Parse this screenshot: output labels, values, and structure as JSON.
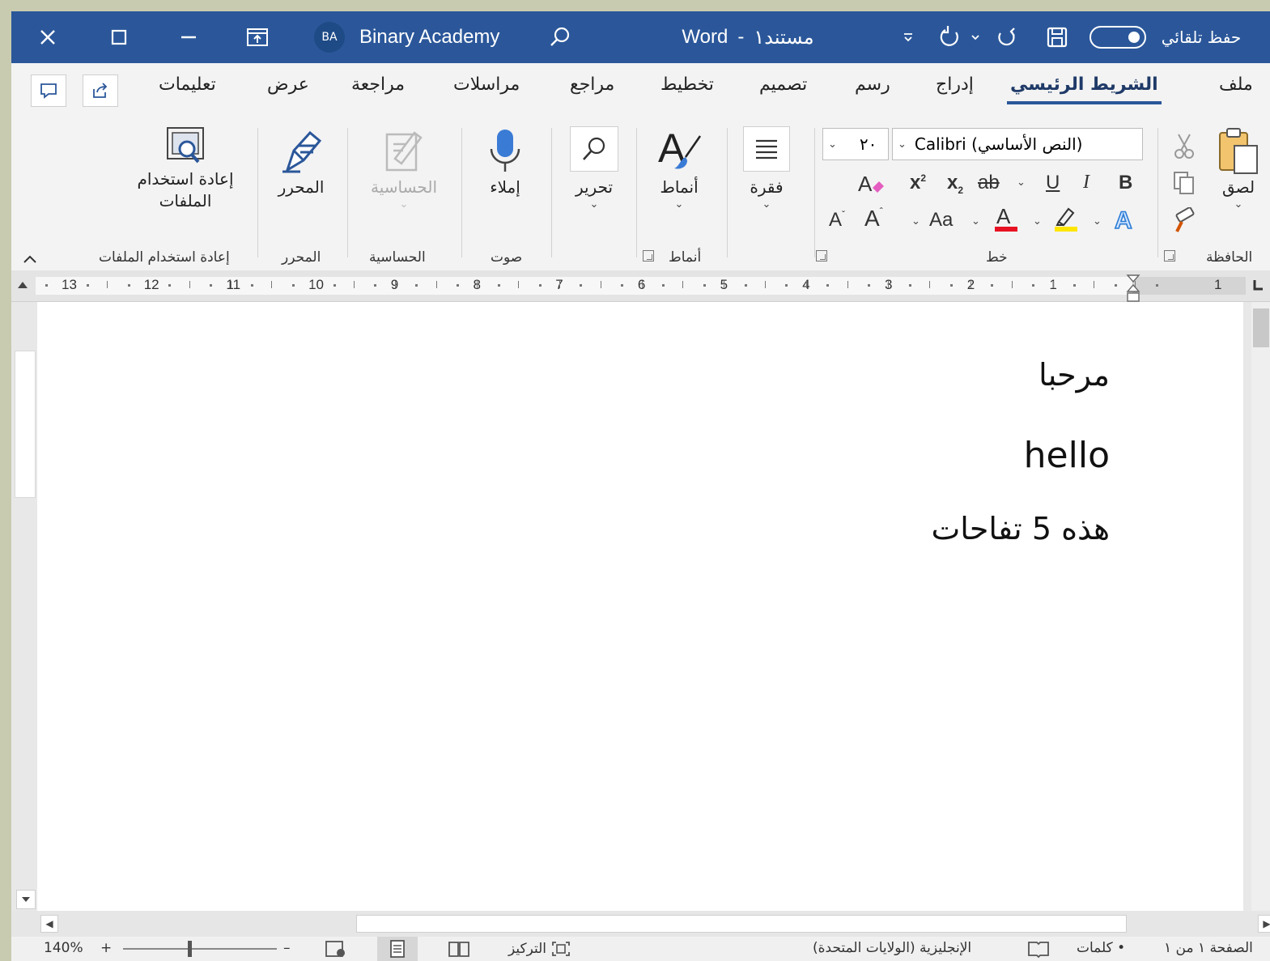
{
  "titlebar": {
    "account_initials": "BA",
    "account_name": "Binary Academy",
    "doc_name": "مستند١",
    "app_name": "Word",
    "separator": "-",
    "autosave_label": "حفظ تلقائي",
    "bg_color": "#2b579a"
  },
  "tabs": {
    "file": "ملف",
    "home": "الشريط الرئيسي",
    "insert": "إدراج",
    "draw": "رسم",
    "design": "تصميم",
    "layout": "تخطيط",
    "references": "مراجع",
    "mailings": "مراسلات",
    "review": "مراجعة",
    "view": "عرض",
    "help": "تعليمات"
  },
  "ribbon": {
    "clipboard": {
      "paste": "لصق",
      "group": "الحافظة"
    },
    "font": {
      "font_name": "Calibri (النص الأساسي)",
      "font_size": "٢٠",
      "change_case": "Aa",
      "group": "خط",
      "font_color": "#e81123",
      "highlight_color": "#ffe600"
    },
    "paragraph": {
      "label": "فقرة"
    },
    "styles": {
      "label": "أنماط",
      "group": "أنماط"
    },
    "editing": {
      "label": "تحرير"
    },
    "voice": {
      "dictate": "إملاء",
      "group": "صوت"
    },
    "sensitivity": {
      "label": "الحساسية",
      "group": "الحساسية"
    },
    "editor": {
      "label": "المحرر",
      "group": "المحرر"
    },
    "reuse": {
      "label_line1": "إعادة استخدام",
      "label_line2": "الملفات",
      "group": "إعادة استخدام الملفات"
    }
  },
  "ruler": {
    "numbers": [
      "13",
      "12",
      "11",
      "10",
      "9",
      "8",
      "7",
      "6",
      "5",
      "4",
      "3",
      "2",
      "1",
      "1"
    ]
  },
  "document": {
    "lines": [
      "مرحبا",
      "hello",
      "هذه 5 تفاحات"
    ]
  },
  "statusbar": {
    "page": "الصفحة ١ من ١",
    "words": "كلمات",
    "language": "الإنجليزية (الولايات المتحدة)",
    "focus": "التركيز",
    "zoom": "140%",
    "zoom_in": "+",
    "zoom_out": "–"
  }
}
